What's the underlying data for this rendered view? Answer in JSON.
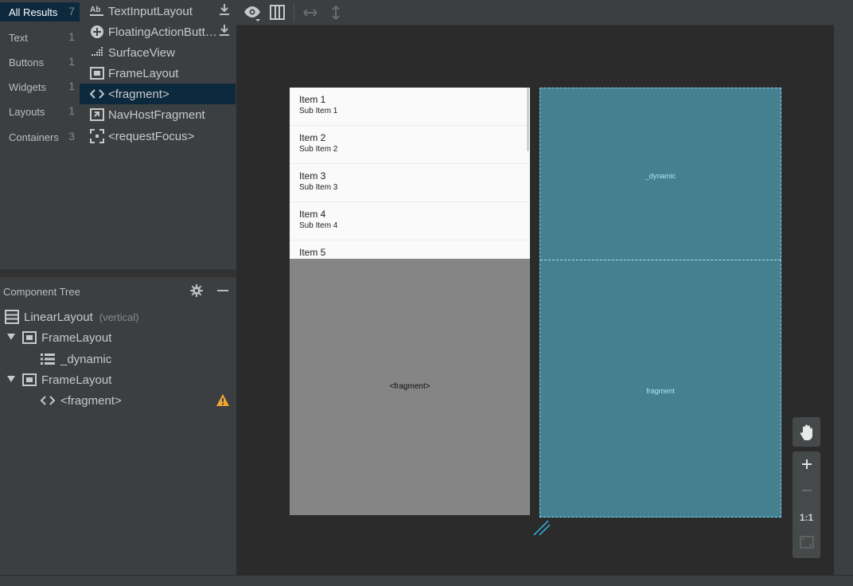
{
  "palette": {
    "categories": [
      {
        "label": "All Results",
        "count": "7"
      },
      {
        "label": "Text",
        "count": "1"
      },
      {
        "label": "Buttons",
        "count": "1"
      },
      {
        "label": "Widgets",
        "count": "1"
      },
      {
        "label": "Layouts",
        "count": "1"
      },
      {
        "label": "Containers",
        "count": "3"
      }
    ],
    "items": [
      {
        "label": "TextInputLayout",
        "icon": "text-input-layout-icon"
      },
      {
        "label": "FloatingActionButt…",
        "icon": "fab-icon"
      },
      {
        "label": "SurfaceView",
        "icon": "surface-view-icon"
      },
      {
        "label": "FrameLayout",
        "icon": "frame-layout-icon"
      },
      {
        "label": "<fragment>",
        "icon": "code-brackets-icon"
      },
      {
        "label": "NavHostFragment",
        "icon": "nav-host-icon"
      },
      {
        "label": "<requestFocus>",
        "icon": "focus-icon"
      }
    ]
  },
  "component_tree": {
    "title": "Component Tree",
    "nodes": [
      {
        "label": "LinearLayout",
        "sub": "(vertical)"
      },
      {
        "label": "FrameLayout"
      },
      {
        "label": "_dynamic"
      },
      {
        "label": "FrameLayout"
      },
      {
        "label": "<fragment>"
      }
    ]
  },
  "design": {
    "list_items": [
      {
        "title": "Item 1",
        "subtitle": "Sub Item 1"
      },
      {
        "title": "Item 2",
        "subtitle": "Sub Item 2"
      },
      {
        "title": "Item 3",
        "subtitle": "Sub Item 3"
      },
      {
        "title": "Item 4",
        "subtitle": "Sub Item 4"
      },
      {
        "title": "Item 5",
        "subtitle": ""
      }
    ],
    "fragment_label": "<fragment>"
  },
  "blueprint": {
    "top_label": "_dynamic",
    "bottom_label": "fragment"
  },
  "zoom": {
    "one_to_one": "1:1"
  },
  "colors": {
    "selection": "#0d293e",
    "blueprint": "#44808f",
    "warning": "#f0a732"
  }
}
